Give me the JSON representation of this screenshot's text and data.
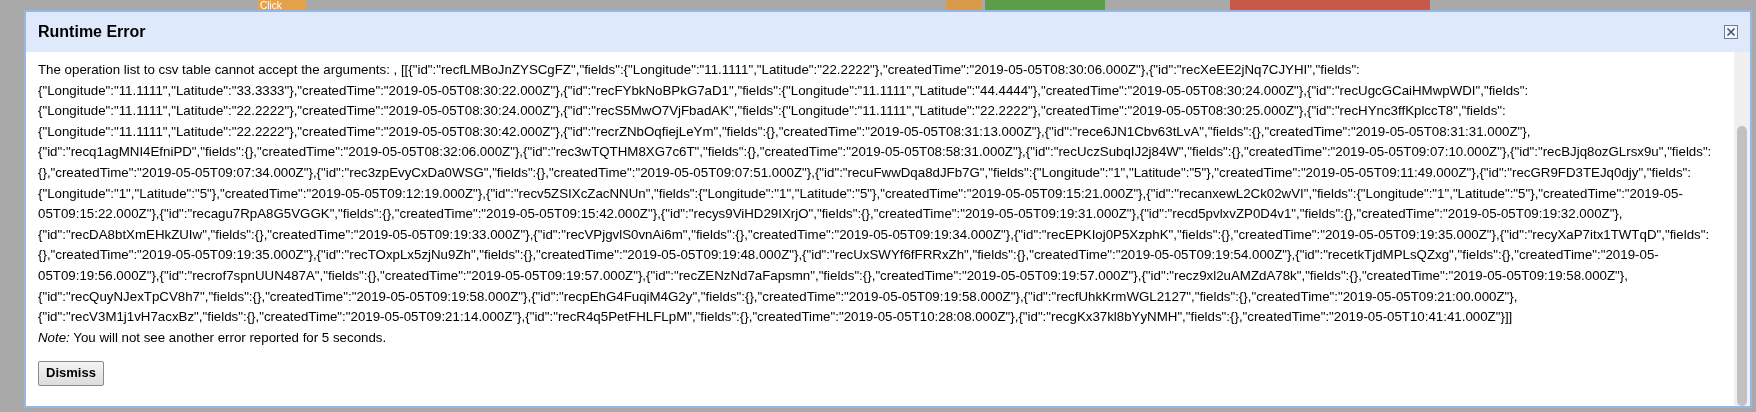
{
  "background": {
    "block_label": "Click"
  },
  "dialog": {
    "title": "Runtime Error",
    "message": "The operation list to csv table cannot accept the arguments: , [[{\"id\":\"recfLMBoJnZYSCgFZ\",\"fields\":{\"Longitude\":\"11.1111\",\"Latitude\":\"22.2222\"},\"createdTime\":\"2019-05-05T08:30:06.000Z\"},{\"id\":\"recXeEE2jNq7CJYHI\",\"fields\":{\"Longitude\":\"11.1111\",\"Latitude\":\"33.3333\"},\"createdTime\":\"2019-05-05T08:30:22.000Z\"},{\"id\":\"recFYbkNoBPkG7aD1\",\"fields\":{\"Longitude\":\"11.1111\",\"Latitude\":\"44.4444\"},\"createdTime\":\"2019-05-05T08:30:24.000Z\"},{\"id\":\"recUgcGCaiHMwpWDI\",\"fields\":{\"Longitude\":\"11.1111\",\"Latitude\":\"22.2222\"},\"createdTime\":\"2019-05-05T08:30:24.000Z\"},{\"id\":\"recS5MwO7VjFbadAK\",\"fields\":{\"Longitude\":\"11.1111\",\"Latitude\":\"22.2222\"},\"createdTime\":\"2019-05-05T08:30:25.000Z\"},{\"id\":\"recHYnc3ffKplccT8\",\"fields\":{\"Longitude\":\"11.1111\",\"Latitude\":\"22.2222\"},\"createdTime\":\"2019-05-05T08:30:42.000Z\"},{\"id\":\"recrZNbOqfiejLeYm\",\"fields\":{},\"createdTime\":\"2019-05-05T08:31:13.000Z\"},{\"id\":\"rece6JN1Cbv63tLvA\",\"fields\":{},\"createdTime\":\"2019-05-05T08:31:31.000Z\"},{\"id\":\"recq1agMNI4EfniPD\",\"fields\":{},\"createdTime\":\"2019-05-05T08:32:06.000Z\"},{\"id\":\"rec3wTQTHM8XG7c6T\",\"fields\":{},\"createdTime\":\"2019-05-05T08:58:31.000Z\"},{\"id\":\"recUczSubqIJ2j84W\",\"fields\":{},\"createdTime\":\"2019-05-05T09:07:10.000Z\"},{\"id\":\"recBJjq8ozGLrsx9u\",\"fields\":{},\"createdTime\":\"2019-05-05T09:07:34.000Z\"},{\"id\":\"rec3zpEvyCxDa0WSG\",\"fields\":{},\"createdTime\":\"2019-05-05T09:07:51.000Z\"},{\"id\":\"recuFwwDqa8dJFb7G\",\"fields\":{\"Longitude\":\"1\",\"Latitude\":\"5\"},\"createdTime\":\"2019-05-05T09:11:49.000Z\"},{\"id\":\"recGR9FD3TEJq0djy\",\"fields\":{\"Longitude\":\"1\",\"Latitude\":\"5\"},\"createdTime\":\"2019-05-05T09:12:19.000Z\"},{\"id\":\"recv5ZSIXcZacNNUn\",\"fields\":{\"Longitude\":\"1\",\"Latitude\":\"5\"},\"createdTime\":\"2019-05-05T09:15:21.000Z\"},{\"id\":\"recanxewL2Ck02wVI\",\"fields\":{\"Longitude\":\"1\",\"Latitude\":\"5\"},\"createdTime\":\"2019-05-05T09:15:22.000Z\"},{\"id\":\"recagu7RpA8G5VGGK\",\"fields\":{},\"createdTime\":\"2019-05-05T09:15:42.000Z\"},{\"id\":\"recys9ViHD29IXrjO\",\"fields\":{},\"createdTime\":\"2019-05-05T09:19:31.000Z\"},{\"id\":\"recd5pvlxvZP0D4v1\",\"fields\":{},\"createdTime\":\"2019-05-05T09:19:32.000Z\"},{\"id\":\"recDA8btXmEHkZUIw\",\"fields\":{},\"createdTime\":\"2019-05-05T09:19:33.000Z\"},{\"id\":\"recVPjgvlS0vnAi6m\",\"fields\":{},\"createdTime\":\"2019-05-05T09:19:34.000Z\"},{\"id\":\"recEPKIoj0P5XzphK\",\"fields\":{},\"createdTime\":\"2019-05-05T09:19:35.000Z\"},{\"id\":\"recyXaP7itx1TWTqD\",\"fields\":{},\"createdTime\":\"2019-05-05T09:19:35.000Z\"},{\"id\":\"recTOxpLx5zjNu9Zh\",\"fields\":{},\"createdTime\":\"2019-05-05T09:19:48.000Z\"},{\"id\":\"recUxSWYf6fFRRxZh\",\"fields\":{},\"createdTime\":\"2019-05-05T09:19:54.000Z\"},{\"id\":\"recetkTjdMPLsQZxg\",\"fields\":{},\"createdTime\":\"2019-05-05T09:19:56.000Z\"},{\"id\":\"recrof7spnUUN487A\",\"fields\":{},\"createdTime\":\"2019-05-05T09:19:57.000Z\"},{\"id\":\"recZENzNd7aFapsmn\",\"fields\":{},\"createdTime\":\"2019-05-05T09:19:57.000Z\"},{\"id\":\"recz9xl2uAMZdA78k\",\"fields\":{},\"createdTime\":\"2019-05-05T09:19:58.000Z\"},{\"id\":\"recQuyNJexTpCV8h7\",\"fields\":{},\"createdTime\":\"2019-05-05T09:19:58.000Z\"},{\"id\":\"recpEhG4FuqiM4G2y\",\"fields\":{},\"createdTime\":\"2019-05-05T09:19:58.000Z\"},{\"id\":\"recfUhkKrmWGL2127\",\"fields\":{},\"createdTime\":\"2019-05-05T09:21:00.000Z\"},{\"id\":\"recV3M1j1vH7acxBz\",\"fields\":{},\"createdTime\":\"2019-05-05T09:21:14.000Z\"},{\"id\":\"recR4q5PetFHLFLpM\",\"fields\":{},\"createdTime\":\"2019-05-05T10:28:08.000Z\"},{\"id\":\"recgKx37kl8bYyNMH\",\"fields\":{},\"createdTime\":\"2019-05-05T10:41:41.000Z\"}]]",
    "note": "*Note:* You will not see another error reported for 5 seconds.",
    "buttons": [
      "Dismiss"
    ]
  }
}
